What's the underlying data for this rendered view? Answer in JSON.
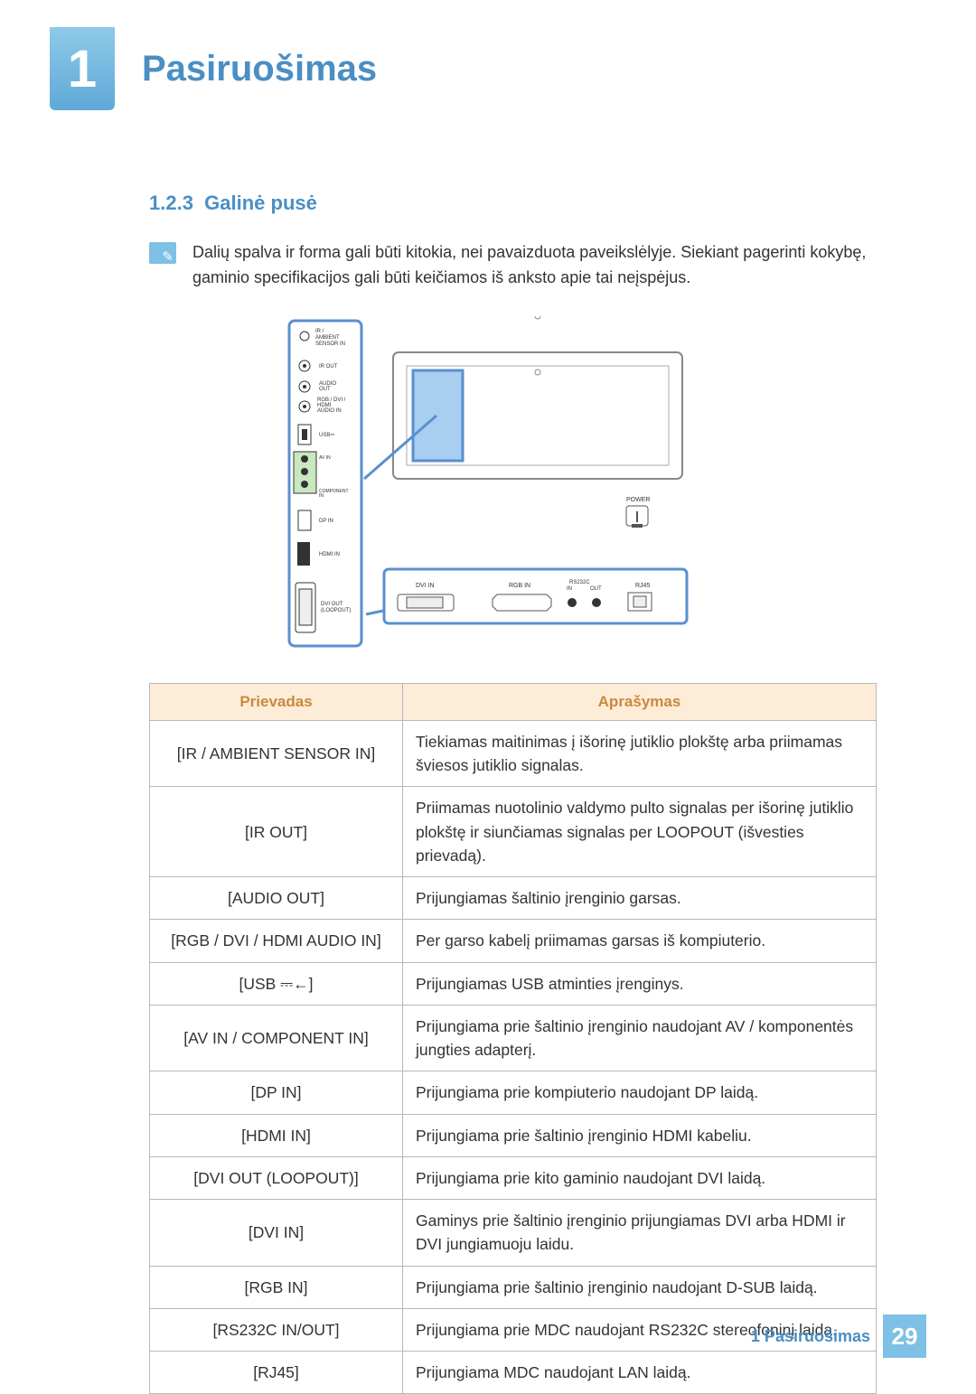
{
  "chapter": {
    "number": "1",
    "title": "Pasiruošimas"
  },
  "section": {
    "number": "1.2.3",
    "title": "Galinė pusė"
  },
  "note": "Dalių spalva ir forma gali būti kitokia, nei pavaizduota paveikslėlyje. Siekiant pagerinti kokybę, gaminio specifikacijos gali būti keičiamos iš anksto apie tai neįspėjus.",
  "diagram": {
    "left_panel_ports": [
      "IR / AMBIENT SENSOR IN",
      "IR OUT",
      "AUDIO OUT",
      "RGB / DVI / HDMI AUDIO IN",
      "USB",
      "AV IN / COMPONENT IN",
      "DP IN",
      "HDMI IN",
      "DVI OUT (LOOPOUT)"
    ],
    "power_label": "POWER",
    "bottom_ports": [
      "DVI IN",
      "RGB IN",
      "RS232C IN",
      "RS232C OUT",
      "RJ45"
    ]
  },
  "table": {
    "headers": {
      "port": "Prievadas",
      "desc": "Aprašymas"
    },
    "rows": [
      {
        "port": "[IR / AMBIENT SENSOR IN]",
        "desc": "Tiekiamas maitinimas į išorinę jutiklio plokštę arba priimamas šviesos jutiklio signalas."
      },
      {
        "port": "[IR OUT]",
        "desc": "Priimamas nuotolinio valdymo pulto signalas per išorinę jutiklio plokštę ir siunčiamas signalas per LOOPOUT (išvesties prievadą)."
      },
      {
        "port": "[AUDIO OUT]",
        "desc": "Prijungiamas šaltinio įrenginio garsas."
      },
      {
        "port": "[RGB / DVI / HDMI AUDIO IN]",
        "desc": "Per garso kabelį priimamas garsas iš kompiuterio."
      },
      {
        "port": "[USB ⎓←]",
        "desc": "Prijungiamas USB atminties įrenginys."
      },
      {
        "port": "[AV IN / COMPONENT IN]",
        "desc": "Prijungiama prie šaltinio įrenginio naudojant AV / komponentės jungties adapterį."
      },
      {
        "port": "[DP IN]",
        "desc": "Prijungiama prie kompiuterio naudojant DP laidą."
      },
      {
        "port": "[HDMI IN]",
        "desc": "Prijungiama prie šaltinio įrenginio HDMI kabeliu."
      },
      {
        "port": "[DVI OUT (LOOPOUT)]",
        "desc": "Prijungiama prie kito gaminio naudojant DVI laidą."
      },
      {
        "port": "[DVI IN]",
        "desc": "Gaminys prie šaltinio įrenginio prijungiamas DVI arba HDMI ir DVI jungiamuoju laidu."
      },
      {
        "port": "[RGB IN]",
        "desc": "Prijungiama prie šaltinio įrenginio naudojant D-SUB laidą."
      },
      {
        "port": "[RS232C IN/OUT]",
        "desc": "Prijungiama prie MDC naudojant RS232C stereofoninį laidą."
      },
      {
        "port": "[RJ45]",
        "desc": "Prijungiama MDC naudojant LAN laidą."
      }
    ]
  },
  "footer": {
    "text": "1 Pasiruošimas",
    "page": "29"
  }
}
